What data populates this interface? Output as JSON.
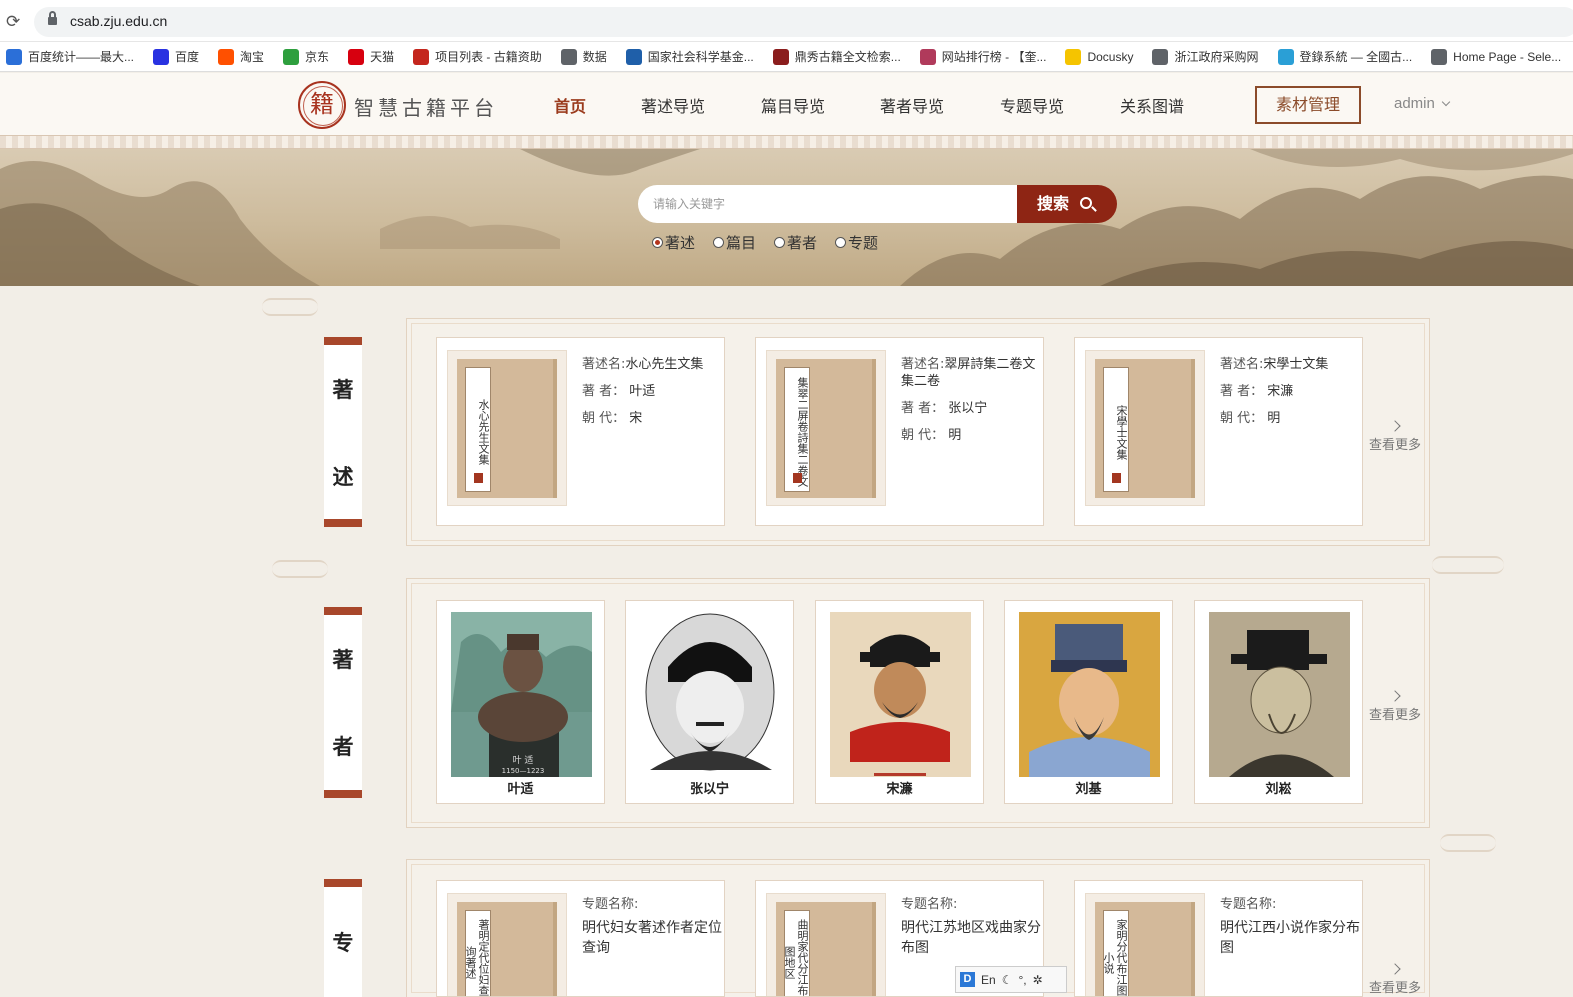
{
  "browser": {
    "url": "csab.zju.edu.cn",
    "bookmarks": [
      {
        "label": "百度统计——最大...",
        "icon": "baidu-tongji-icon",
        "color": "#2b6fd8"
      },
      {
        "label": "百度",
        "icon": "baidu-paw-icon",
        "color": "#2932e1"
      },
      {
        "label": "淘宝",
        "icon": "taobao-icon",
        "color": "#ff5000"
      },
      {
        "label": "京东",
        "icon": "jd-icon",
        "color": "#2e9f3e"
      },
      {
        "label": "天猫",
        "icon": "tmall-icon",
        "color": "#d7000f"
      },
      {
        "label": "项目列表 - 古籍资助",
        "icon": "project-icon",
        "color": "#c4261d"
      },
      {
        "label": "数据",
        "icon": "globe-icon",
        "color": "#5f6368"
      },
      {
        "label": "国家社会科学基金...",
        "icon": "nssf-icon",
        "color": "#1f5fa9"
      },
      {
        "label": "鼎秀古籍全文检索...",
        "icon": "book-icon",
        "color": "#8b1d1d"
      },
      {
        "label": "网站排行榜 - 【奎...",
        "icon": "ranking-icon",
        "color": "#b03a5b"
      },
      {
        "label": "Docusky",
        "icon": "docusky-icon",
        "color": "#f5c400"
      },
      {
        "label": "浙江政府采购网",
        "icon": "globe-icon",
        "color": "#5f6368"
      },
      {
        "label": "登錄系統 — 全國古...",
        "icon": "login-icon",
        "color": "#2a9fd6"
      },
      {
        "label": "Home Page - Sele...",
        "icon": "globe-icon",
        "color": "#5f6368"
      }
    ]
  },
  "header": {
    "logo_char": "籍",
    "site_name": "智慧古籍平台",
    "nav": [
      "首页",
      "著述导览",
      "篇目导览",
      "著者导览",
      "专题导览",
      "关系图谱"
    ],
    "active_nav": "首页",
    "material_button": "素材管理",
    "user": "admin"
  },
  "search": {
    "placeholder": "请输入关键字",
    "button": "搜索",
    "options": [
      "著述",
      "篇目",
      "著者",
      "专题"
    ],
    "selected": "著述"
  },
  "sections": {
    "works": {
      "tab": [
        "著",
        "述"
      ],
      "more": "查看更多",
      "items": [
        {
          "cover_title": "水心先生文集",
          "name_label": "著述名:",
          "name": "水心先生文集",
          "author_label": "著 者：",
          "author": "叶适",
          "dynasty_label": "朝 代：",
          "dynasty": "宋"
        },
        {
          "cover_title": "集翠二屏卷詩集二卷文",
          "name_label": "著述名:",
          "name": "翠屏詩集二卷文集二卷",
          "author_label": "著 者：",
          "author": "张以宁",
          "dynasty_label": "朝 代：",
          "dynasty": "明"
        },
        {
          "cover_title": "宋學士文集",
          "name_label": "著述名:",
          "name": "宋學士文集",
          "author_label": "著 者：",
          "author": "宋濂",
          "dynasty_label": "朝 代：",
          "dynasty": "明"
        }
      ]
    },
    "authors": {
      "tab": [
        "著",
        "者"
      ],
      "more": "查看更多",
      "items": [
        {
          "name": "叶适",
          "statue_caption": "叶 适",
          "statue_years": "1150—1223"
        },
        {
          "name": "张以宁"
        },
        {
          "name": "宋濂"
        },
        {
          "name": "刘基"
        },
        {
          "name": "刘崧"
        }
      ]
    },
    "topics": {
      "tab": [
        "专"
      ],
      "more": "查看更多",
      "items": [
        {
          "cover_title": "著明定代位妇查女询著述",
          "label": "专题名称:",
          "name": "明代妇女著述作者定位查询"
        },
        {
          "cover_title": "曲明家代分江布苏图地区",
          "label": "专题名称:",
          "name": "明代江苏地区戏曲家分布图"
        },
        {
          "cover_title": "家明分代布江图西小说",
          "label": "专题名称:",
          "name": "明代江西小说作家分布图"
        }
      ]
    }
  },
  "ime": {
    "badge": "D",
    "lang": "En"
  },
  "colors": {
    "accent": "#8e2514",
    "frame": "#a8472b",
    "background": "#f2eee7"
  }
}
